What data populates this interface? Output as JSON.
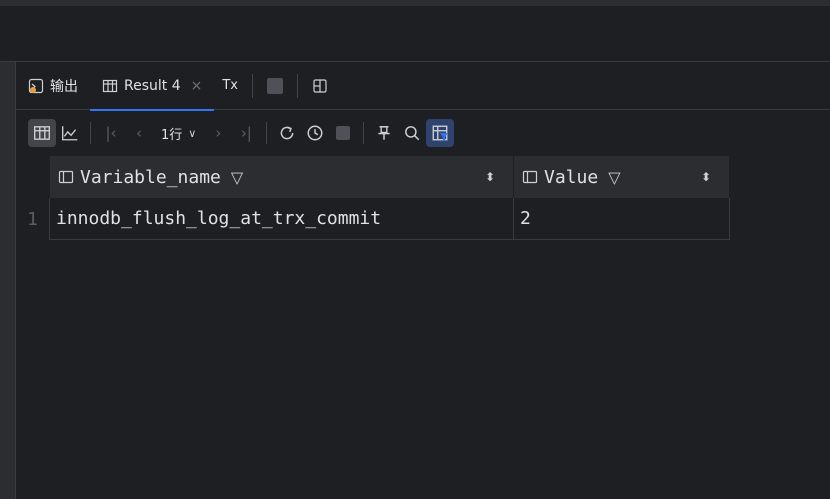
{
  "tabs": {
    "output_label": "输出",
    "result_label": "Result 4",
    "close_glyph": "×",
    "tx_label": "Tx"
  },
  "toolbar": {
    "row_count": "1行",
    "icons": [
      "table-view-icon",
      "chart-view-icon",
      "first-page-icon",
      "prev-page-icon",
      "next-page-icon",
      "last-page-icon",
      "reload-icon",
      "history-icon",
      "stop-icon",
      "pin-icon",
      "search-icon",
      "filter-layout-icon"
    ]
  },
  "grid": {
    "columns": [
      {
        "name": "Variable_name"
      },
      {
        "name": "Value"
      }
    ],
    "rows": [
      {
        "num": "1",
        "cells": [
          "innodb_flush_log_at_trx_commit",
          "2"
        ]
      }
    ]
  },
  "colors": {
    "background": "#1e1f22",
    "panel": "#2b2d30",
    "accent": "#3574f0",
    "text": "#dfe1e5"
  }
}
